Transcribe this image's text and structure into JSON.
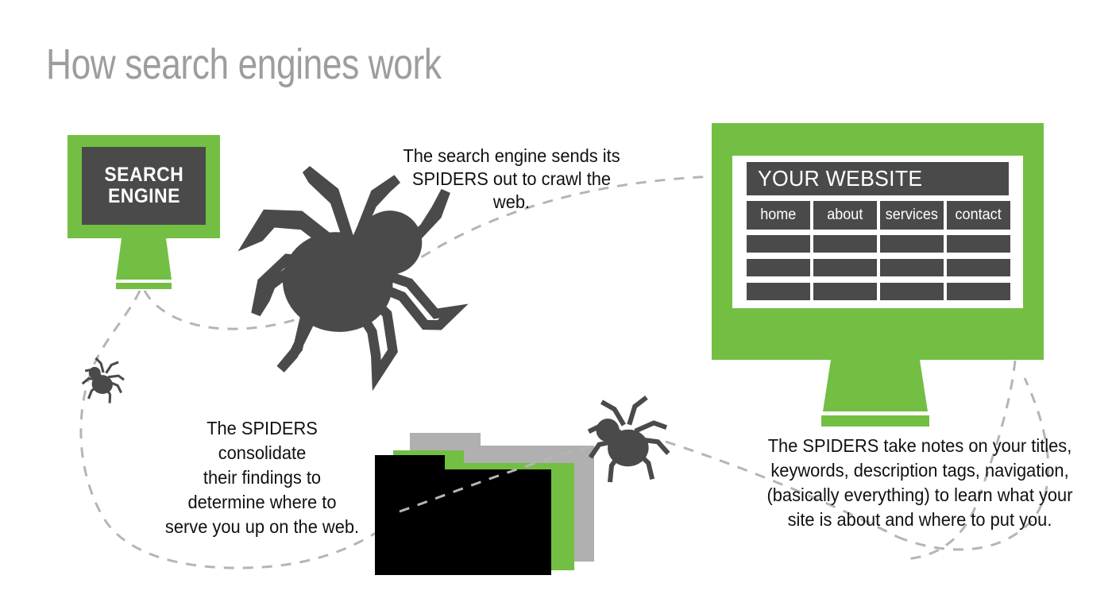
{
  "page": {
    "title": "How search engines work",
    "background_color": "#ffffff",
    "accent_green": "#72bf44",
    "dark_gray": "#4a4a4a",
    "title_gray": "#9d9d9d",
    "dash_gray": "#b5b5b5",
    "folder_gray": "#b0b0b0",
    "folder_black": "#000000"
  },
  "search_engine": {
    "label_line1": "SEARCH",
    "label_line2": "ENGINE",
    "frame_color": "#72bf44",
    "screen_color": "#4a4a4a"
  },
  "website": {
    "header": "YOUR WEBSITE",
    "nav": [
      {
        "label": "home"
      },
      {
        "label": "about"
      },
      {
        "label": "services"
      },
      {
        "label": "contact"
      }
    ],
    "content_rows": 3,
    "content_columns": 4,
    "frame_color": "#72bf44",
    "page_color": "#ffffff",
    "block_color": "#4a4a4a"
  },
  "callouts": {
    "crawl": {
      "lines": [
        "The search engine sends its",
        "SPIDERS out to crawl the web."
      ]
    },
    "consolidate": {
      "lines": [
        "The SPIDERS consolidate",
        "their findings to",
        "determine where to",
        "serve you up on the web."
      ]
    },
    "notes": {
      "lines": [
        "The SPIDERS take notes on your titles,",
        "keywords, description tags, navigation,",
        "(basically everything) to learn what your",
        "site is about and where to put you."
      ]
    }
  },
  "icons": {
    "spider_large": "spider-icon",
    "spider_medium": "spider-icon",
    "spider_small": "spider-icon",
    "folders": "folder-stack-icon"
  },
  "folders": [
    {
      "name": "folder-back",
      "color": "#b0b0b0"
    },
    {
      "name": "folder-middle",
      "color": "#72bf44"
    },
    {
      "name": "folder-front",
      "color": "#000000"
    }
  ]
}
